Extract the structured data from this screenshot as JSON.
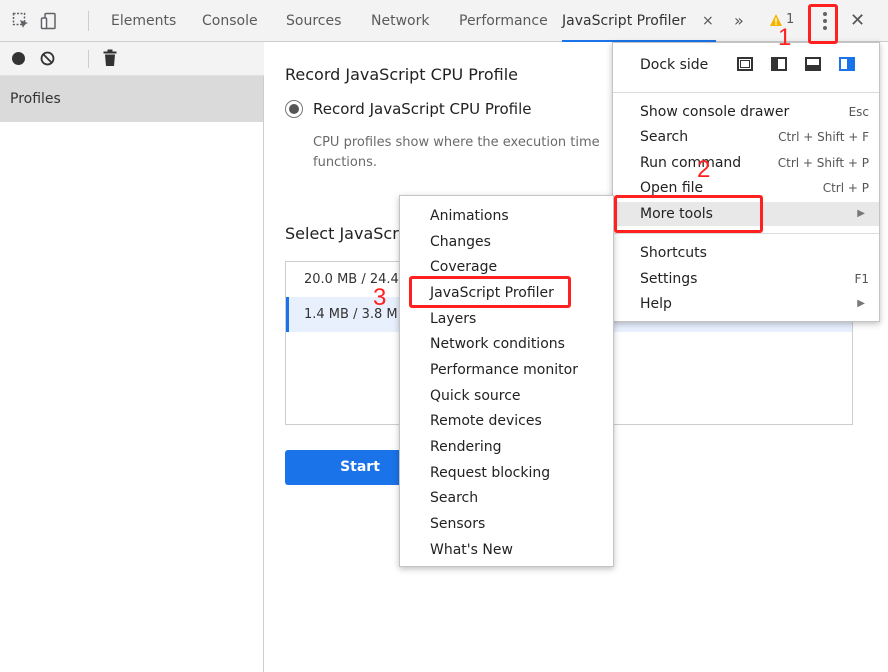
{
  "toolbar": {
    "tabs": [
      {
        "label": "Elements"
      },
      {
        "label": "Console"
      },
      {
        "label": "Sources"
      },
      {
        "label": "Network"
      },
      {
        "label": "Performance"
      },
      {
        "label": "JavaScript Profiler"
      }
    ],
    "tab_close": "×",
    "overflow": "»",
    "warning_count": "1",
    "close": "✕"
  },
  "sidebar": {
    "profiles_label": "Profiles"
  },
  "main": {
    "record_heading": "Record JavaScript CPU Profile",
    "radio_label": "Record JavaScript CPU Profile",
    "description_line1": "CPU profiles show where the execution time",
    "description_line2": "functions.",
    "select_heading": "Select JavaScr",
    "vm_instances": [
      {
        "label": "20.0 MB / 24.4"
      },
      {
        "label": "1.4 MB / 3.8 M"
      }
    ],
    "start_label": "Start"
  },
  "menu": {
    "dock_side_label": "Dock side",
    "items": [
      {
        "label": "Show console drawer",
        "shortcut": "Esc"
      },
      {
        "label": "Search",
        "shortcut": "Ctrl + Shift + F"
      },
      {
        "label": "Run command",
        "shortcut": "Ctrl + Shift + P"
      },
      {
        "label": "Open file",
        "shortcut": "Ctrl + P"
      },
      {
        "label": "More tools"
      },
      {
        "label": "Shortcuts"
      },
      {
        "label": "Settings",
        "shortcut": "F1"
      },
      {
        "label": "Help"
      }
    ]
  },
  "submenu": {
    "items": [
      {
        "label": "Animations"
      },
      {
        "label": "Changes"
      },
      {
        "label": "Coverage"
      },
      {
        "label": "JavaScript Profiler"
      },
      {
        "label": "Layers"
      },
      {
        "label": "Network conditions"
      },
      {
        "label": "Performance monitor"
      },
      {
        "label": "Quick source"
      },
      {
        "label": "Remote devices"
      },
      {
        "label": "Rendering"
      },
      {
        "label": "Request blocking"
      },
      {
        "label": "Search"
      },
      {
        "label": "Sensors"
      },
      {
        "label": "What's New"
      }
    ]
  },
  "annotations": {
    "step1": "1",
    "step2": "2",
    "step3": "3"
  },
  "colors": {
    "accent": "#1a73e8",
    "annotation": "#ff2020",
    "warning": "#f4b400"
  }
}
